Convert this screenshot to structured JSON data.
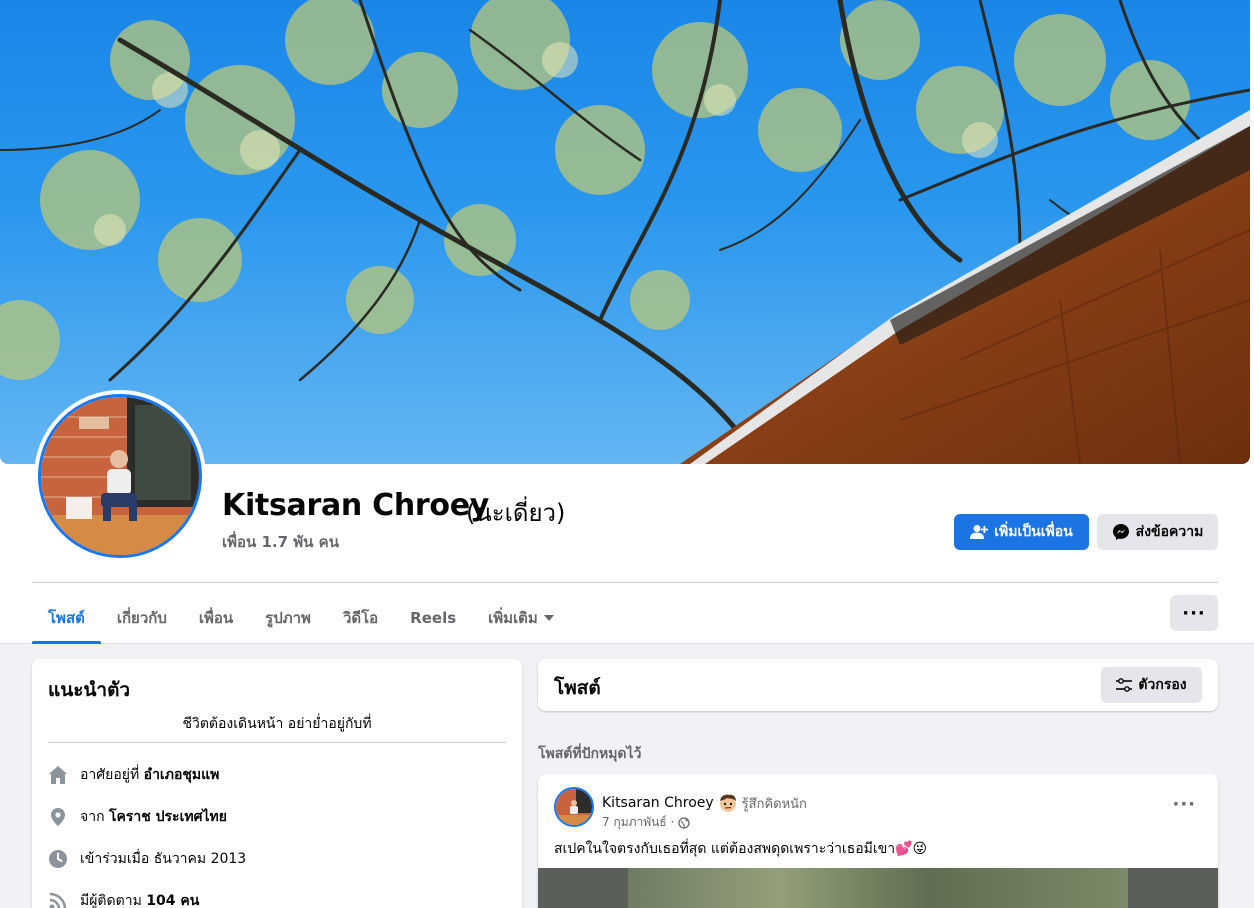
{
  "profile": {
    "name": "Kitsaran Chroey",
    "alternate_name": "(นะเดี่ยว)",
    "friends_count": "เพื่อน 1.7 พัน คน"
  },
  "actions": {
    "add_friend": "เพิ่มเป็นเพื่อน",
    "message": "ส่งข้อความ"
  },
  "tabs": [
    {
      "label": "โพสต์",
      "active": true
    },
    {
      "label": "เกี่ยวกับ"
    },
    {
      "label": "เพื่อน"
    },
    {
      "label": "รูปภาพ"
    },
    {
      "label": "วิดีโอ"
    },
    {
      "label": "Reels"
    },
    {
      "label": "เพิ่มเติม"
    }
  ],
  "more_button": "···",
  "intro": {
    "title": "แนะนำตัว",
    "bio": "ชีวิตต้องเดินหน้า อย่าย่ำอยู่กับที่",
    "lives_prefix": "อาศัยอยู่ที่",
    "lives_value": "อำเภอชุมแพ",
    "from_prefix": "จาก",
    "from_value": "โคราช ประเทศไทย",
    "joined": "เข้าร่วมเมื่อ ธันวาคม 2013",
    "followers_prefix": "มีผู้ติดตาม",
    "followers_value": "104 คน"
  },
  "posts": {
    "title": "โพสต์",
    "filter_label": "ตัวกรอง",
    "pinned_label": "โพสต์ที่ปักหมุดไว้"
  },
  "post": {
    "author": "Kitsaran Chroey",
    "feeling": "รู้สึกคิดหนัก",
    "date": "7 กุมภาพันธ์ ·",
    "text": "สเปคในใจตรงกับเธอที่สุด แต่ต้องสพดุดเพราะว่าเธอมีเขา💕😜",
    "menu": "···"
  },
  "colors": {
    "accent": "#1b74e4",
    "secondary_button": "#e4e6eb",
    "page_background": "#f0f2f5"
  },
  "icons": [
    "add-friend-icon",
    "messenger-icon",
    "dropdown-caret-icon",
    "home-icon",
    "location-pin-icon",
    "clock-icon",
    "rss-icon",
    "filter-icon",
    "globe-icon",
    "thinking-emoji-icon"
  ]
}
